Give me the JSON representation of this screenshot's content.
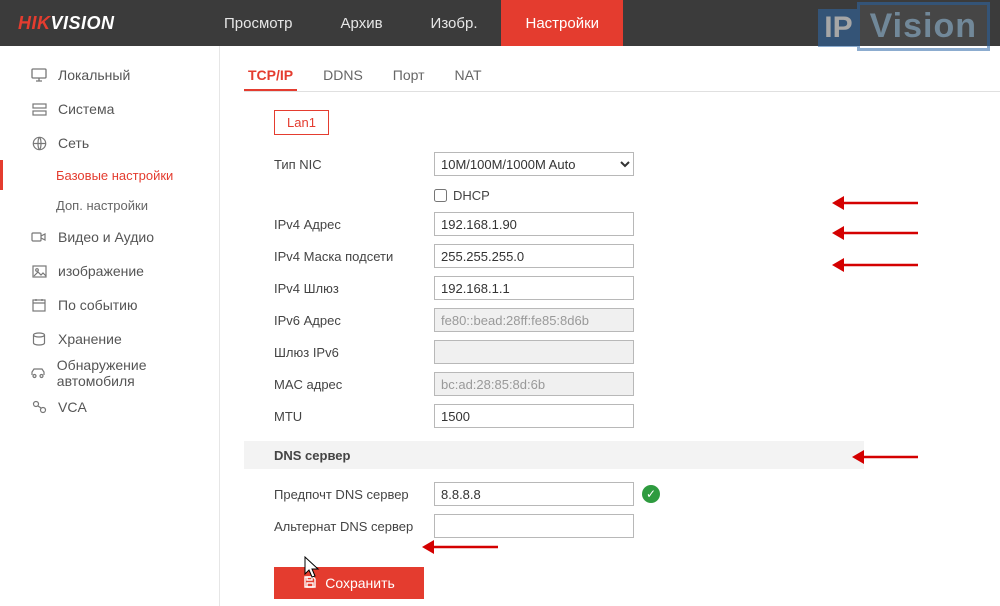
{
  "logo": {
    "prefix": "HIK",
    "suffix": "VISION"
  },
  "topnav": {
    "items": [
      {
        "label": "Просмотр"
      },
      {
        "label": "Архив"
      },
      {
        "label": "Изобр."
      },
      {
        "label": "Настройки",
        "active": true
      }
    ]
  },
  "sidebar": {
    "items": [
      {
        "label": "Локальный",
        "icon": "monitor"
      },
      {
        "label": "Система",
        "icon": "system"
      },
      {
        "label": "Сеть",
        "icon": "globe",
        "expanded": true,
        "subs": [
          {
            "label": "Базовые настройки",
            "active": true
          },
          {
            "label": "Доп. настройки"
          }
        ]
      },
      {
        "label": "Видео и Аудио",
        "icon": "av"
      },
      {
        "label": "изображение",
        "icon": "image"
      },
      {
        "label": "По событию",
        "icon": "event"
      },
      {
        "label": "Хранение",
        "icon": "storage"
      },
      {
        "label": "Обнаружение автомобиля",
        "icon": "car"
      },
      {
        "label": "VCA",
        "icon": "vca"
      }
    ]
  },
  "subtabs": {
    "items": [
      {
        "label": "TCP/IP",
        "active": true
      },
      {
        "label": "DDNS"
      },
      {
        "label": "Порт"
      },
      {
        "label": "NAT"
      }
    ]
  },
  "lan_tab": "Lan1",
  "form": {
    "nic_type_label": "Тип NIC",
    "nic_type_value": "10M/100M/1000M Auto",
    "dhcp_label": "DHCP",
    "dhcp_checked": false,
    "ipv4_addr_label": "IPv4 Адрес",
    "ipv4_addr_value": "192.168.1.90",
    "ipv4_mask_label": "IPv4 Маска подсети",
    "ipv4_mask_value": "255.255.255.0",
    "ipv4_gw_label": "IPv4 Шлюз",
    "ipv4_gw_value": "192.168.1.1",
    "ipv6_addr_label": "IPv6 Адрес",
    "ipv6_addr_value": "fe80::bead:28ff:fe85:8d6b",
    "ipv6_gw_label": "Шлюз IPv6",
    "ipv6_gw_value": "",
    "mac_label": "MAC адрес",
    "mac_value": "bc:ad:28:85:8d:6b",
    "mtu_label": "MTU",
    "mtu_value": "1500",
    "dns_section": "DNS сервер",
    "dns_pref_label": "Предпочт DNS сервер",
    "dns_pref_value": "8.8.8.8",
    "dns_alt_label": "Альтернат DNS сервер",
    "dns_alt_value": ""
  },
  "save_label": "Сохранить",
  "watermark": {
    "ip": "IP",
    "vision": "Vision"
  }
}
